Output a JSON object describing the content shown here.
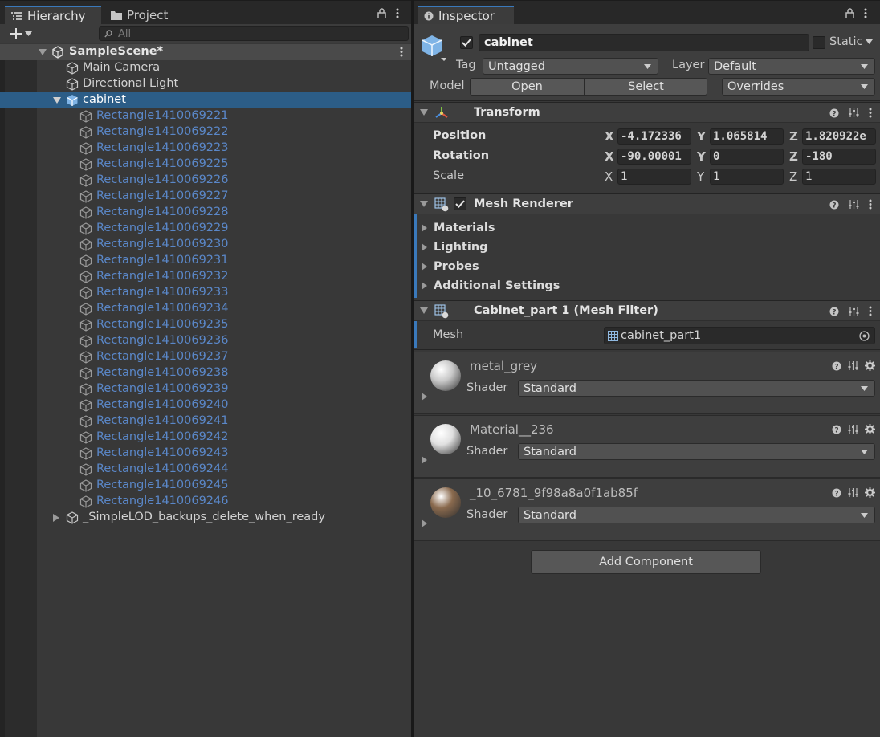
{
  "hierarchy": {
    "tab_label": "Hierarchy",
    "project_tab_label": "Project",
    "search_placeholder": "All",
    "scene_name": "SampleScene*",
    "items": [
      {
        "label": "Main Camera"
      },
      {
        "label": "Directional Light"
      },
      {
        "label": "cabinet"
      }
    ],
    "children": [
      "Rectangle1410069221",
      "Rectangle1410069222",
      "Rectangle1410069223",
      "Rectangle1410069225",
      "Rectangle1410069226",
      "Rectangle1410069227",
      "Rectangle1410069228",
      "Rectangle1410069229",
      "Rectangle1410069230",
      "Rectangle1410069231",
      "Rectangle1410069232",
      "Rectangle1410069233",
      "Rectangle1410069234",
      "Rectangle1410069235",
      "Rectangle1410069236",
      "Rectangle1410069237",
      "Rectangle1410069238",
      "Rectangle1410069239",
      "Rectangle1410069240",
      "Rectangle1410069241",
      "Rectangle1410069242",
      "Rectangle1410069243",
      "Rectangle1410069244",
      "Rectangle1410069245",
      "Rectangle1410069246"
    ],
    "last_item": "_SimpleLOD_backups_delete_when_ready"
  },
  "inspector": {
    "tab_label": "Inspector",
    "object_name": "cabinet",
    "static_label": "Static",
    "tag_label": "Tag",
    "tag_value": "Untagged",
    "layer_label": "Layer",
    "layer_value": "Default",
    "model_label": "Model",
    "open_label": "Open",
    "select_label": "Select",
    "overrides_label": "Overrides",
    "transform": {
      "title": "Transform",
      "position_label": "Position",
      "rotation_label": "Rotation",
      "scale_label": "Scale",
      "position": {
        "x": "-4.172336",
        "y": "1.065814",
        "z": "1.820922e"
      },
      "rotation": {
        "x": "-90.00001",
        "y": "0",
        "z": "-180"
      },
      "scale": {
        "x": "1",
        "y": "1",
        "z": "1"
      }
    },
    "mesh_renderer": {
      "title": "Mesh Renderer",
      "sections": [
        "Materials",
        "Lighting",
        "Probes",
        "Additional Settings"
      ]
    },
    "mesh_filter": {
      "title": "Cabinet_part 1 (Mesh Filter)",
      "mesh_label": "Mesh",
      "mesh_value": "cabinet_part1"
    },
    "materials": [
      {
        "name": "metal_grey",
        "shader_label": "Shader",
        "shader": "Standard",
        "color": "#c8c8c8"
      },
      {
        "name": "Material__236",
        "shader_label": "Shader",
        "shader": "Standard",
        "color": "#e0e0e0"
      },
      {
        "name": "_10_6781_9f98a8a0f1ab85f",
        "shader_label": "Shader",
        "shader": "Standard",
        "color": "#8a6a4e"
      }
    ],
    "add_component_label": "Add Component"
  },
  "colors": {
    "selection": "#2c5d87",
    "accent": "#3a79bb",
    "prefab_text": "#5a87c8"
  }
}
